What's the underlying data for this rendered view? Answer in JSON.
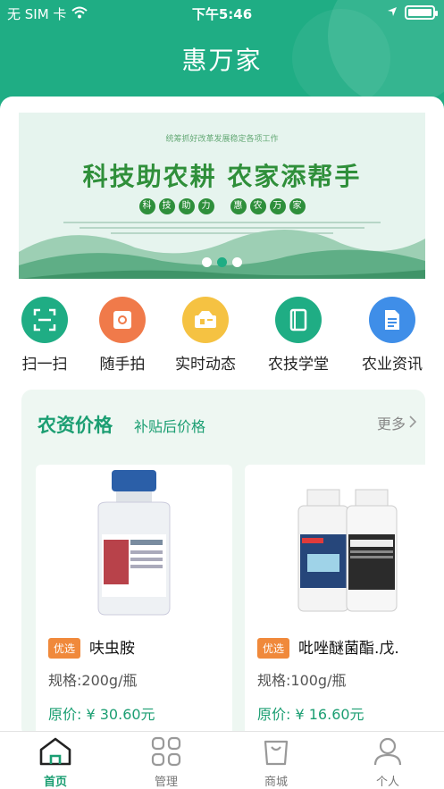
{
  "status_bar": {
    "carrier": "无 SIM 卡",
    "time": "下午5:46"
  },
  "header": {
    "title": "惠万家"
  },
  "banner": {
    "top_caption": "统筹抓好改革发展稳定各项工作",
    "headline": "科技助农耕  农家添帮手",
    "pills_left": [
      "科",
      "技",
      "助",
      "力"
    ],
    "pills_right": [
      "惠",
      "农",
      "万",
      "家"
    ],
    "page_count": 3,
    "active_page": 2
  },
  "actions": [
    {
      "label": "扫一扫",
      "icon": "scan-icon",
      "color": "#1fad84"
    },
    {
      "label": "随手拍",
      "icon": "camera-icon",
      "color": "#f07a4a"
    },
    {
      "label": "实时动态",
      "icon": "news-icon",
      "color": "#f5c242"
    },
    {
      "label": "农技学堂",
      "icon": "book-icon",
      "color": "#1fad84"
    },
    {
      "label": "农业资讯",
      "icon": "document-icon",
      "color": "#3f8ee8"
    }
  ],
  "price_section": {
    "title": "农资价格",
    "subtitle": "补贴后价格",
    "more_label": "更多",
    "products": [
      {
        "tag": "优选",
        "name": "呋虫胺",
        "spec": "规格:200g/瓶",
        "price": "原价: ¥ 30.60元"
      },
      {
        "tag": "优选",
        "name": "吡唑醚菌酯.戊.",
        "spec": "规格:100g/瓶",
        "price": "原价: ¥ 16.60元"
      }
    ]
  },
  "tabbar": {
    "items": [
      {
        "label": "首页",
        "icon": "home-icon",
        "active": true
      },
      {
        "label": "管理",
        "icon": "grid-icon",
        "active": false
      },
      {
        "label": "商城",
        "icon": "shopping-bag-icon",
        "active": false
      },
      {
        "label": "个人",
        "icon": "user-icon",
        "active": false
      }
    ]
  },
  "colors": {
    "brand": "#1fad84",
    "tag": "#f0893b"
  }
}
